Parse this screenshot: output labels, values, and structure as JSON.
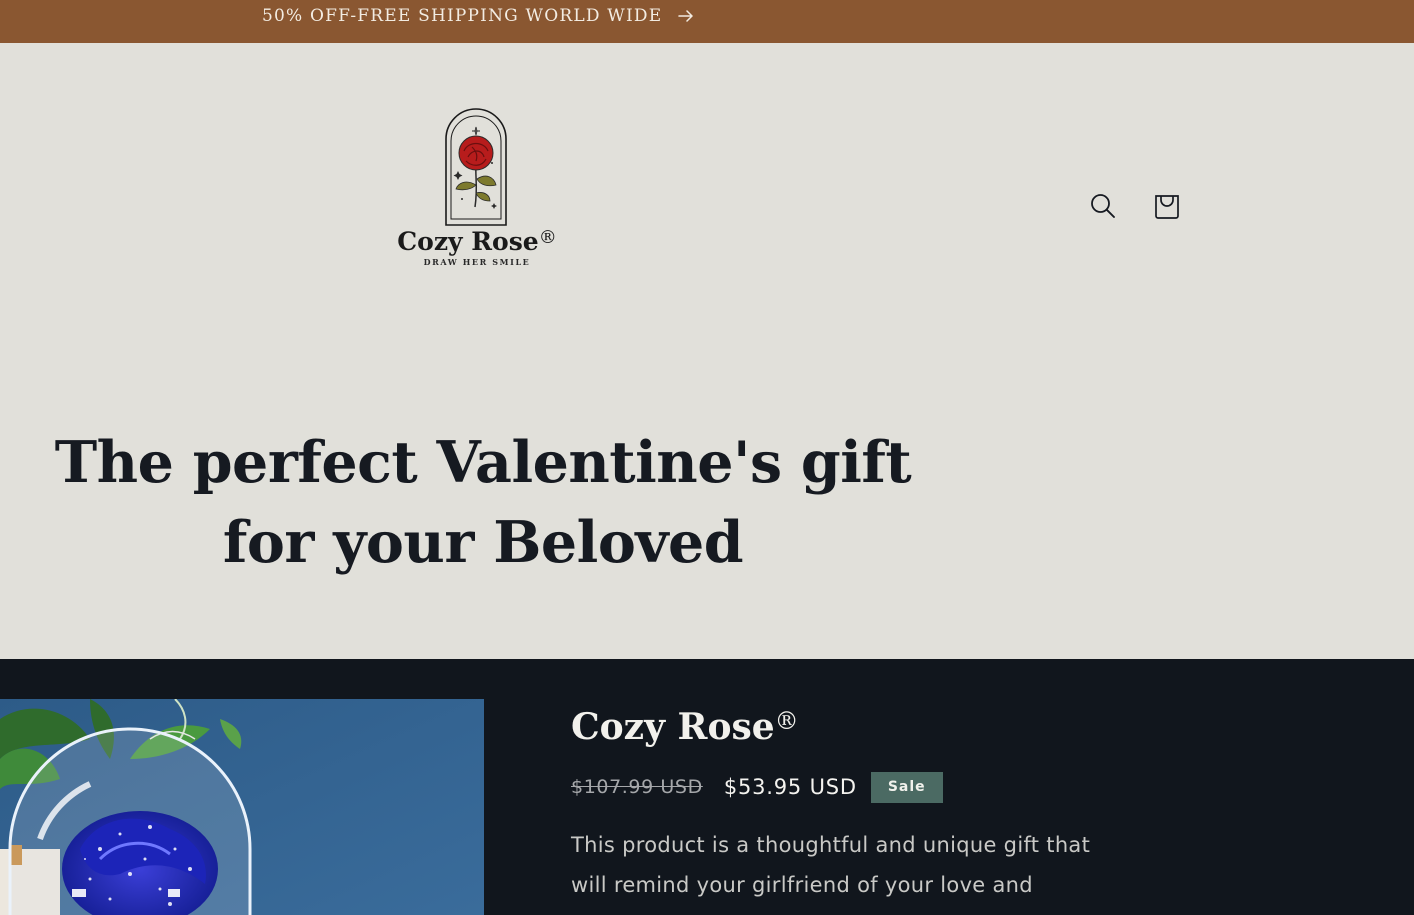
{
  "announcement": {
    "text": "50% OFF-FREE SHIPPING WORLD WIDE",
    "arrow_icon": "arrow-right-icon"
  },
  "header": {
    "logo": {
      "name": "Cozy Rose",
      "registered": "®",
      "tagline": "DRAW HER SMILE"
    },
    "icons": [
      "search-icon",
      "cart-icon"
    ]
  },
  "hero": {
    "title": "The perfect Valentine's gift for your Beloved"
  },
  "product": {
    "title": "Cozy Rose",
    "registered": "®",
    "price_regular": "$107.99 USD",
    "price_sale": "$53.95 USD",
    "badge": "Sale",
    "description": "This product is a thoughtful and unique gift that will remind your girlfriend of your love and"
  },
  "colors": {
    "announcement_bg": "#8a5731",
    "header_bg": "#e1e0da",
    "product_bg": "#11161d",
    "sale_badge_bg": "#4b6a63",
    "rose_red": "#b71c1c",
    "leaf_olive": "#7d7a2e"
  }
}
